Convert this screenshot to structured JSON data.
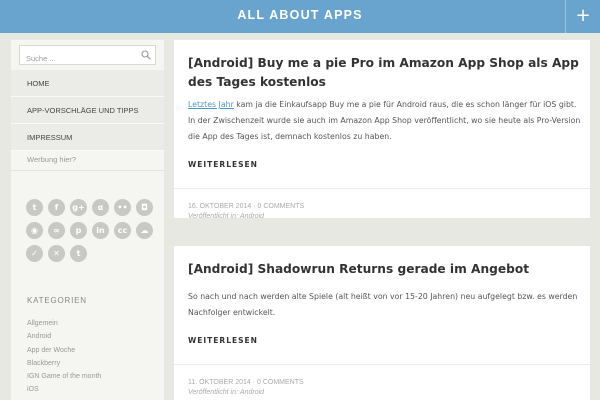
{
  "header": {
    "title": "ALL ABOUT APPS",
    "menu_glyph": "+"
  },
  "colors": {
    "header_bg": "#68a4cd",
    "page_bg": "#e8e8e3",
    "link": "#4f97c5"
  },
  "sidebar": {
    "search_placeholder": "Suche ...",
    "search_icon": "magnifier-icon",
    "nav": [
      {
        "label": "HOME"
      },
      {
        "label": "APP-VORSCHLÄGE UND TIPPS"
      },
      {
        "label": "IMPRESSUM"
      }
    ],
    "werbung": "Werbung hier?",
    "social_icons": [
      {
        "name": "twitter-icon",
        "glyph": "t"
      },
      {
        "name": "facebook-icon",
        "glyph": "f"
      },
      {
        "name": "googleplus-icon",
        "glyph": "g+"
      },
      {
        "name": "appnet-icon",
        "glyph": "α"
      },
      {
        "name": "flickr-icon",
        "glyph": "••"
      },
      {
        "name": "instagram-icon",
        "glyph": "◘"
      },
      {
        "name": "github-icon",
        "glyph": "◉"
      },
      {
        "name": "lastfm-icon",
        "glyph": "∞"
      },
      {
        "name": "pinterest-icon",
        "glyph": "p"
      },
      {
        "name": "linkedin-icon",
        "glyph": "in"
      },
      {
        "name": "creativecommons-icon",
        "glyph": "cc"
      },
      {
        "name": "soundcloud-icon",
        "glyph": "☁"
      },
      {
        "name": "vk-icon",
        "glyph": "✓"
      },
      {
        "name": "xing-icon",
        "glyph": "✕"
      },
      {
        "name": "tumblr-icon",
        "glyph": "t"
      }
    ],
    "categories_heading": "KATEGORIEN",
    "categories": [
      "Allgemein",
      "Android",
      "App der Woche",
      "Blackberry",
      "IGN Game of the month",
      "iOS"
    ]
  },
  "posts": [
    {
      "title": "[Android] Buy me a pie Pro im Amazon App Shop als App des Tages kostenlos",
      "link_text": "Letztes Jahr",
      "excerpt": " kam ja die Einkaufsapp Buy me a pie für Android raus, die es schon länger für iOS gibt. In der Zwischenzeit wurde sie auch im Amazon App Shop veröffentlicht, wo sie heute als Pro-Version die App des Tages ist, demnach kostenlos zu haben.",
      "more": "WEITERLESEN",
      "date_line": "16. OKTOBER 2014 · 0 COMMENTS",
      "published_label": "Veröffentlicht in:",
      "category": "Android"
    },
    {
      "title": "[Android] Shadowrun Returns gerade im Angebot",
      "excerpt": "So nach und nach werden alte Spiele (alt heißt von vor 15-20 Jahren) neu aufgelegt bzw. es werden Nachfolger entwickelt.",
      "more": "WEITERLESEN",
      "date_line": "11. OKTOBER 2014 · 0 COMMENTS",
      "published_label": "Veröffentlicht in:",
      "category": "Android"
    }
  ]
}
